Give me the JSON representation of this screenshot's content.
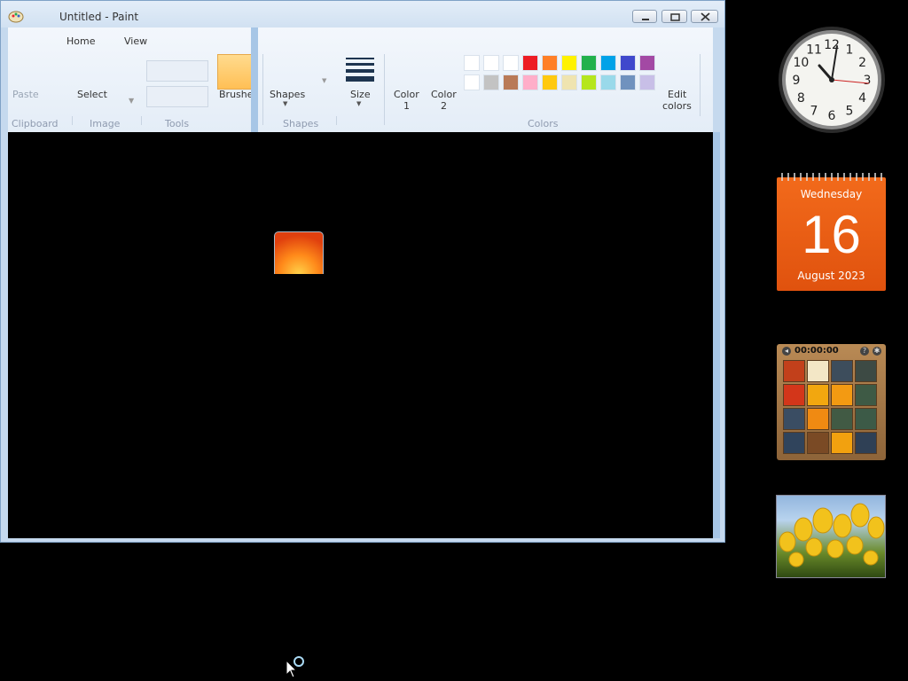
{
  "window": {
    "title": "Untitled - Paint",
    "colors": {
      "frame": "#c5d9ee",
      "ribbon": "#eef3fa",
      "canvas": "#000000"
    }
  },
  "ribbon": {
    "tabs": [
      "Home",
      "View"
    ],
    "items": {
      "paste": "Paste",
      "select": "Select",
      "brushes": "Brushes",
      "shapes": "Shapes",
      "size": "Size",
      "color1_a": "Color",
      "color1_b": "1",
      "color2_a": "Color",
      "color2_b": "2",
      "edit_colors_a": "Edit",
      "edit_colors_b": "colors"
    },
    "groups": {
      "clipboard": "Clipboard",
      "image": "Image",
      "tools": "Tools",
      "shapes": "Shapes",
      "colors": "Colors"
    },
    "palette_row1": [
      "#ffffff",
      "#ffffff",
      "#ffffff",
      "#ed1c24",
      "#ff7f27",
      "#fff200",
      "#22b14c",
      "#00a2e8",
      "#3f48cc",
      "#a349a4"
    ],
    "palette_row2": [
      "#ffffff",
      "#c3c3c3",
      "#b97a57",
      "#ffaec9",
      "#ffc90e",
      "#efe4b0",
      "#b5e61d",
      "#99d9ea",
      "#7092be",
      "#c8bfe7"
    ]
  },
  "gadgets": {
    "clock": {
      "numbers": [
        "12",
        "1",
        "2",
        "3",
        "4",
        "5",
        "6",
        "7",
        "8",
        "9",
        "10",
        "11"
      ],
      "time": "10:05:10"
    },
    "calendar": {
      "weekday": "Wednesday",
      "day": "16",
      "month_year": "August 2023"
    },
    "puzzle": {
      "timer": "00:00:00"
    },
    "slideshow": {
      "icon": "tulips-photo"
    }
  }
}
